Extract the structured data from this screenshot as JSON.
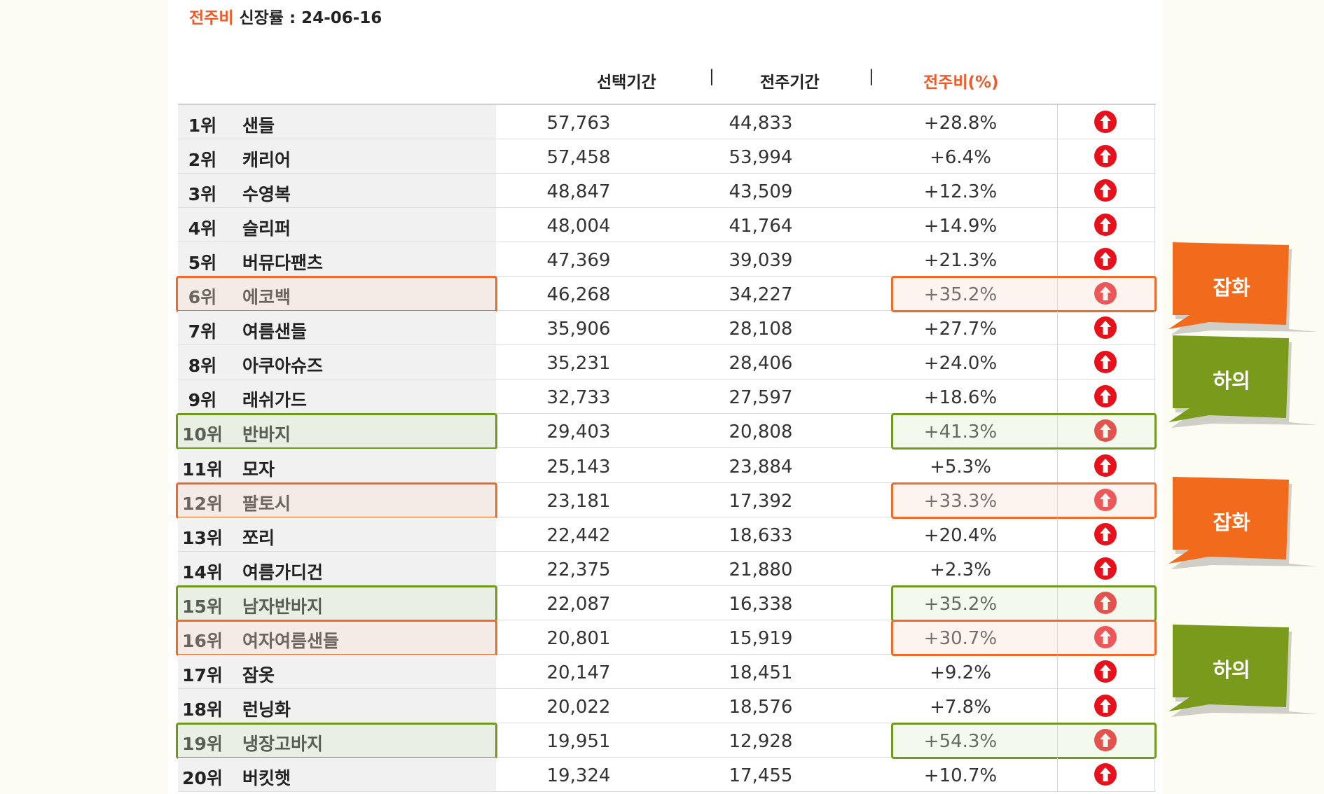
{
  "header": {
    "accent": "전주비",
    "text": " 신장률  : 24-06-16"
  },
  "columns": {
    "selected": "선택기간",
    "previous": "전주기간",
    "ratio": "전주비(%)",
    "separator": "|"
  },
  "rows": [
    {
      "rank": "1위",
      "name": "샌들",
      "selected": "57,763",
      "previous": "44,833",
      "ratio": "+28.8%"
    },
    {
      "rank": "2위",
      "name": "캐리어",
      "selected": "57,458",
      "previous": "53,994",
      "ratio": "+6.4%"
    },
    {
      "rank": "3위",
      "name": "수영복",
      "selected": "48,847",
      "previous": "43,509",
      "ratio": "+12.3%"
    },
    {
      "rank": "4위",
      "name": "슬리퍼",
      "selected": "48,004",
      "previous": "41,764",
      "ratio": "+14.9%"
    },
    {
      "rank": "5위",
      "name": "버뮤다팬츠",
      "selected": "47,369",
      "previous": "39,039",
      "ratio": "+21.3%"
    },
    {
      "rank": "6위",
      "name": "에코백",
      "selected": "46,268",
      "previous": "34,227",
      "ratio": "+35.2%",
      "highlight": "orange"
    },
    {
      "rank": "7위",
      "name": "여름샌들",
      "selected": "35,906",
      "previous": "28,108",
      "ratio": "+27.7%"
    },
    {
      "rank": "8위",
      "name": "아쿠아슈즈",
      "selected": "35,231",
      "previous": "28,406",
      "ratio": "+24.0%"
    },
    {
      "rank": "9위",
      "name": "래쉬가드",
      "selected": "32,733",
      "previous": "27,597",
      "ratio": "+18.6%"
    },
    {
      "rank": "10위",
      "name": "반바지",
      "selected": "29,403",
      "previous": "20,808",
      "ratio": "+41.3%",
      "highlight": "green"
    },
    {
      "rank": "11위",
      "name": "모자",
      "selected": "25,143",
      "previous": "23,884",
      "ratio": "+5.3%"
    },
    {
      "rank": "12위",
      "name": "팔토시",
      "selected": "23,181",
      "previous": "17,392",
      "ratio": "+33.3%",
      "highlight": "orange"
    },
    {
      "rank": "13위",
      "name": "쪼리",
      "selected": "22,442",
      "previous": "18,633",
      "ratio": "+20.4%"
    },
    {
      "rank": "14위",
      "name": "여름가디건",
      "selected": "22,375",
      "previous": "21,880",
      "ratio": "+2.3%"
    },
    {
      "rank": "15위",
      "name": "남자반바지",
      "selected": "22,087",
      "previous": "16,338",
      "ratio": "+35.2%",
      "highlight": "green"
    },
    {
      "rank": "16위",
      "name": "여자여름샌들",
      "selected": "20,801",
      "previous": "15,919",
      "ratio": "+30.7%",
      "highlight": "orange"
    },
    {
      "rank": "17위",
      "name": "잠옷",
      "selected": "20,147",
      "previous": "18,451",
      "ratio": "+9.2%"
    },
    {
      "rank": "18위",
      "name": "런닝화",
      "selected": "20,022",
      "previous": "18,576",
      "ratio": "+7.8%"
    },
    {
      "rank": "19위",
      "name": "냉장고바지",
      "selected": "19,951",
      "previous": "12,928",
      "ratio": "+54.3%",
      "highlight": "green"
    },
    {
      "rank": "20위",
      "name": "버킷햇",
      "selected": "19,324",
      "previous": "17,455",
      "ratio": "+10.7%"
    }
  ],
  "trend_icon": "up-arrow-icon",
  "tags": [
    {
      "label": "잡화",
      "color": "orange"
    },
    {
      "label": "하의",
      "color": "green"
    },
    {
      "label": "잡화",
      "color": "orange"
    },
    {
      "label": "하의",
      "color": "green"
    }
  ],
  "colors": {
    "accent": "#f05a28",
    "orange": "#f26a1b",
    "green": "#7a9a1c",
    "arrow": "#e8101a"
  }
}
